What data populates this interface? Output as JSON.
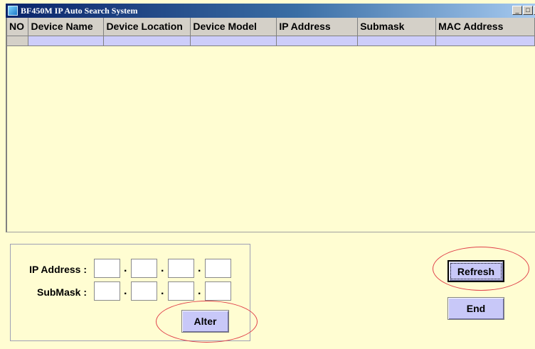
{
  "window": {
    "title": "BF450M IP Auto Search System",
    "controls": {
      "minimize": "_",
      "maximize": "□",
      "close": "×"
    }
  },
  "grid": {
    "columns": [
      "NO",
      "Device Name",
      "Device Location",
      "Device Model",
      "IP Address",
      "Submask",
      "MAC Address"
    ]
  },
  "form": {
    "ip_label": "IP Address :",
    "mask_label": "SubMask :",
    "separator": "."
  },
  "buttons": {
    "alter": "Alter",
    "refresh": "Refresh",
    "end": "End"
  },
  "annotations": {
    "highlight_color": "#e0404a"
  }
}
